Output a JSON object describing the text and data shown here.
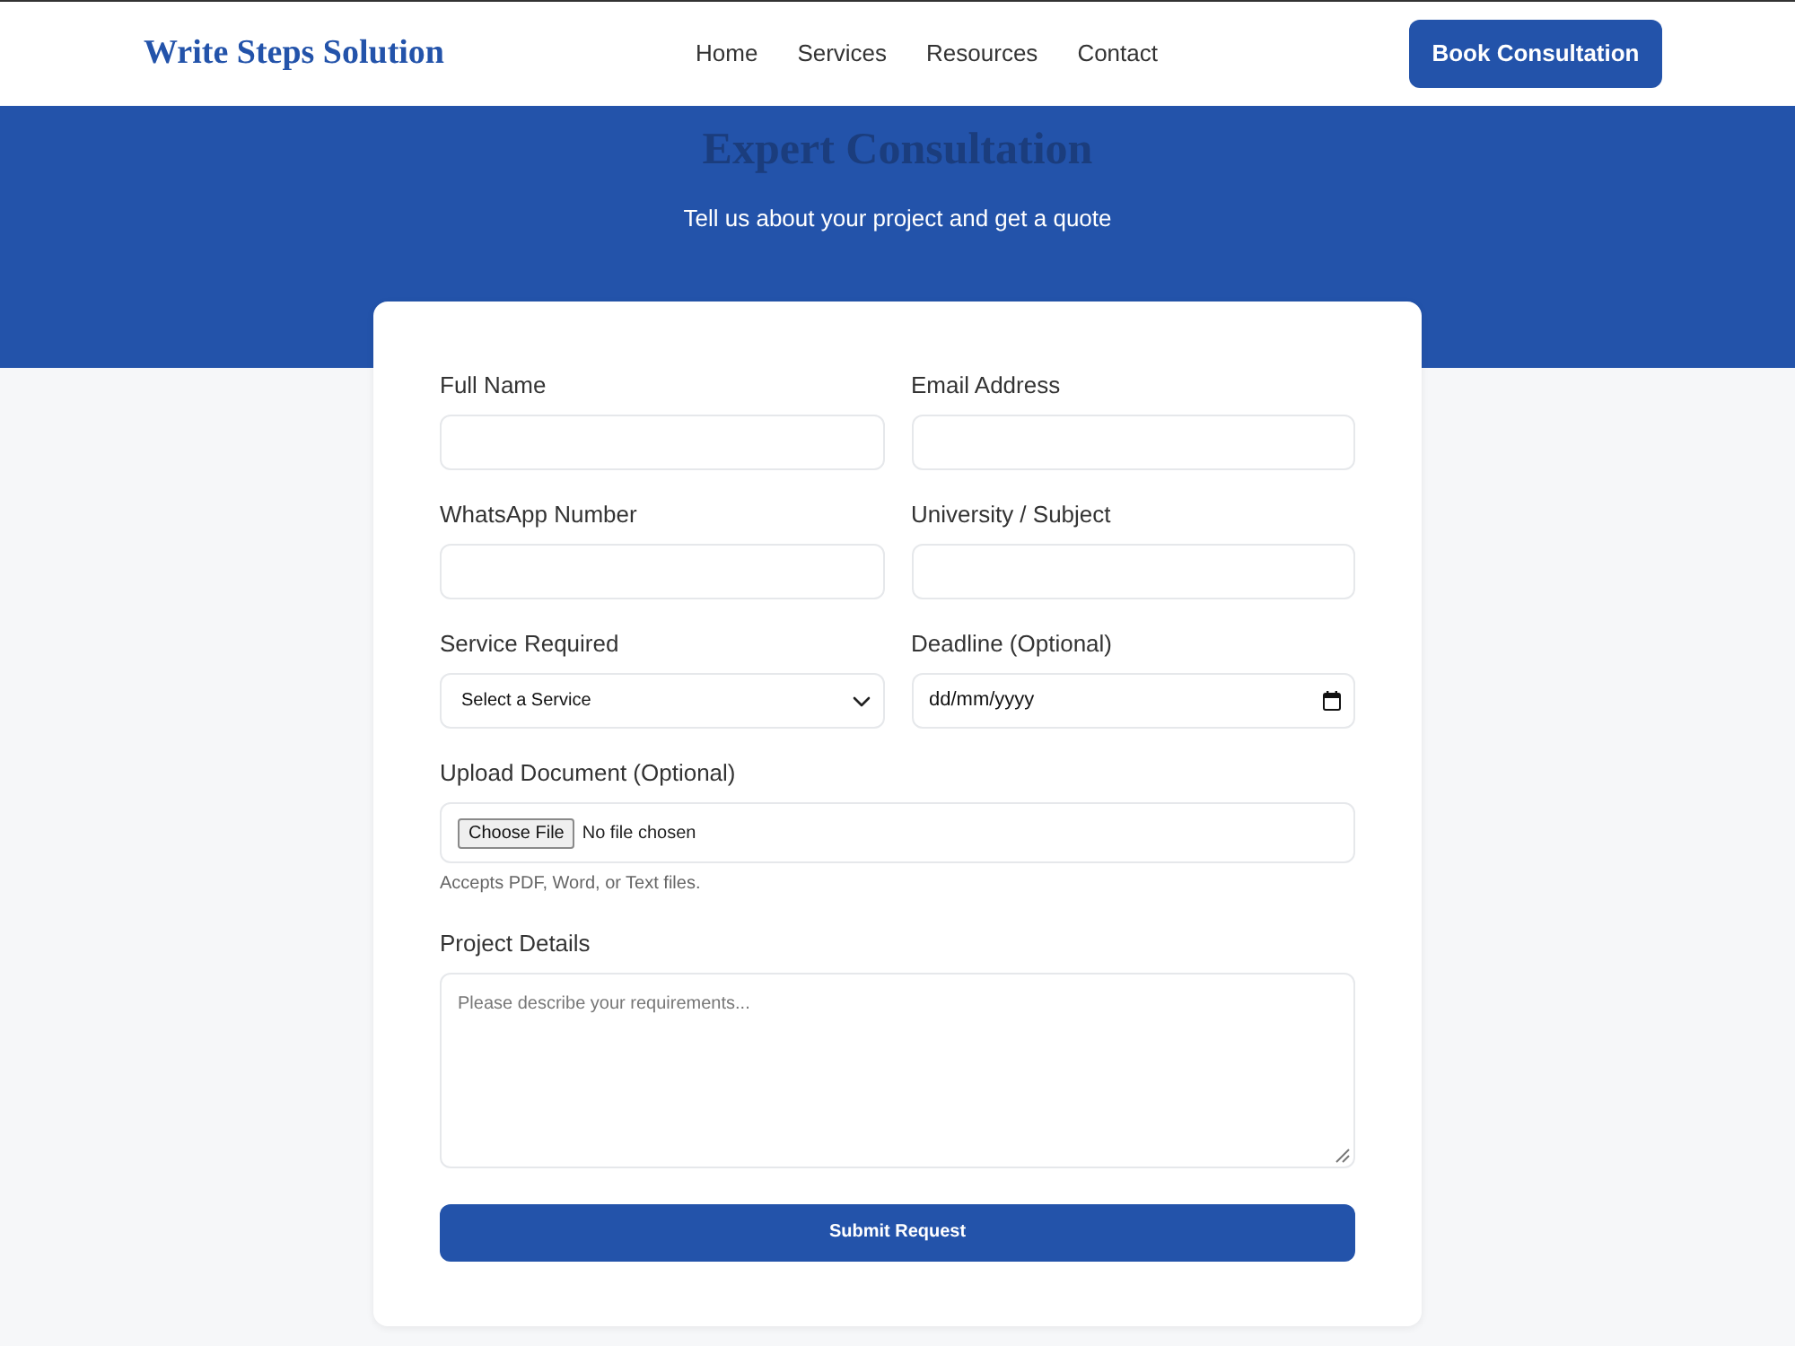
{
  "navbar": {
    "logo": "Write Steps Solution",
    "links": [
      {
        "label": "Home"
      },
      {
        "label": "Services"
      },
      {
        "label": "Resources"
      },
      {
        "label": "Contact"
      }
    ],
    "cta": "Book Consultation"
  },
  "hero": {
    "title": "Expert Consultation",
    "subtitle": "Tell us about your project and get a quote"
  },
  "form": {
    "fields": [
      {
        "kind": "input",
        "label": "Full Name"
      },
      {
        "kind": "input",
        "label": "Email Address"
      },
      {
        "kind": "input",
        "label": "WhatsApp Number"
      },
      {
        "kind": "input",
        "label": "University / Subject"
      },
      {
        "kind": "select",
        "label": "Service Required",
        "value": "Select a Service"
      },
      {
        "kind": "date",
        "label": "Deadline (Optional)",
        "value": "dd/mm/yyyy"
      },
      {
        "kind": "file",
        "label": "Upload Document (Optional)",
        "button": "Choose File",
        "status": "No file chosen",
        "hint": "Accepts PDF, Word, or Text files."
      },
      {
        "kind": "textarea",
        "label": "Project Details",
        "placeholder": "Please describe your requirements..."
      }
    ],
    "submit": "Submit Request"
  }
}
